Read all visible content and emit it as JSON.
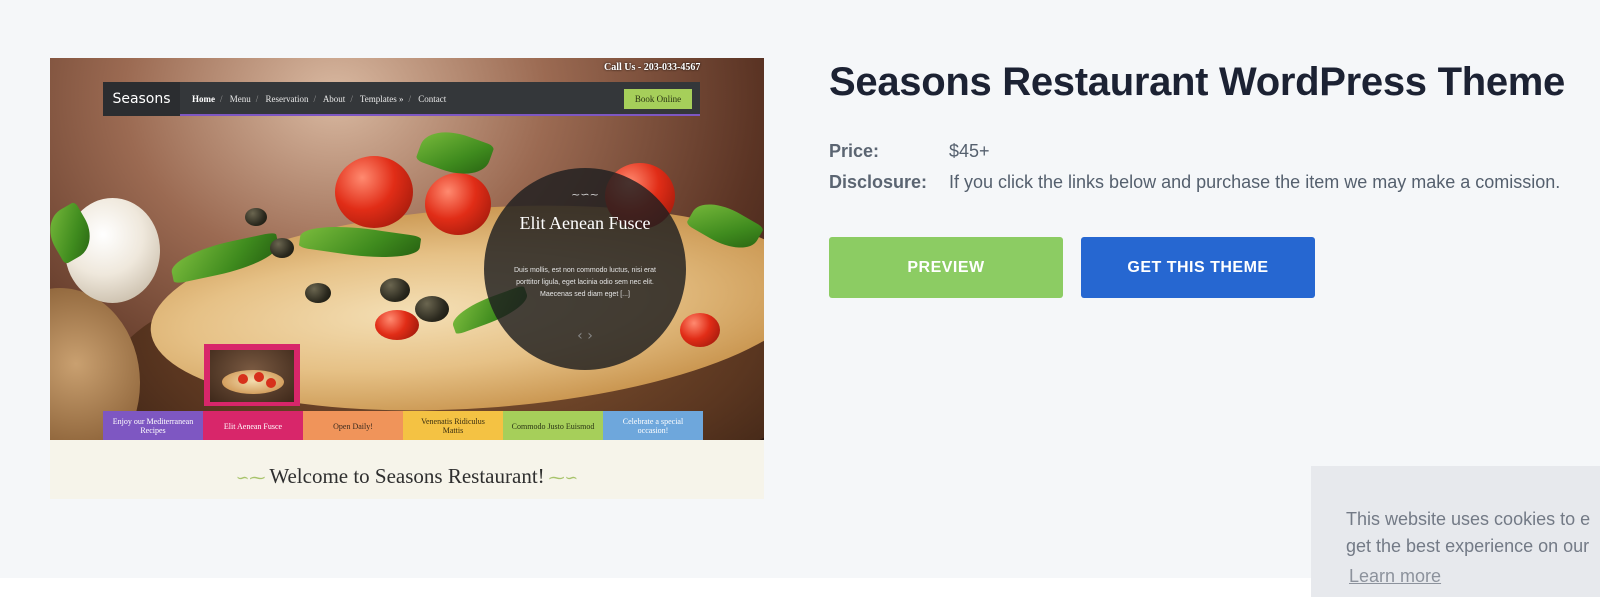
{
  "preview_image": {
    "site_logo": "Seasons",
    "call_us": "Call Us - 203-033-4567",
    "nav": [
      "Home",
      "Menu",
      "Reservation",
      "About",
      "Templates »",
      "Contact"
    ],
    "book_button": "Book Online",
    "slide": {
      "title": "Elit Aenean Fusce",
      "body": "Duis mollis, est non commodo luctus, nisi erat porttitor ligula, eget lacinia odio sem nec elit. Maecenas sed diam eget [...]"
    },
    "tabs": [
      {
        "label": "Enjoy our Mediterranean Recipes",
        "color": "#7e57c2",
        "text_color": "#ffffff"
      },
      {
        "label": "Elit Aenean Fusce",
        "color": "#d8266a",
        "text_color": "#ffffff"
      },
      {
        "label": "Open Daily!",
        "color": "#f0945a",
        "text_color": "#3a2a1e"
      },
      {
        "label": "Venenatis Ridiculus Mattis",
        "color": "#f4c243",
        "text_color": "#3a2e10"
      },
      {
        "label": "Commodo Justo Euismod",
        "color": "#a6cf5a",
        "text_color": "#2a3414"
      },
      {
        "label": "Celebrate a special occasion!",
        "color": "#6ea7dc",
        "text_color": "#ffffff"
      }
    ],
    "welcome": "Welcome to Seasons Restaurant!"
  },
  "product": {
    "title": "Seasons Restaurant WordPress Theme",
    "price_label": "Price:",
    "price_value": "$45+",
    "disclosure_label": "Disclosure:",
    "disclosure_value": "If you click the links below and purchase the item we may make a comission.",
    "preview_button": "PREVIEW",
    "get_button": "GET THIS THEME"
  },
  "cookie_banner": {
    "line1": "This website uses cookies to e",
    "line2": "get the best experience on our",
    "learn_more": "Learn more"
  },
  "colors": {
    "page_bg": "#f5f7f9",
    "title": "#1c2233",
    "preview_button": "#8ccc63",
    "get_button": "#2667d1"
  }
}
